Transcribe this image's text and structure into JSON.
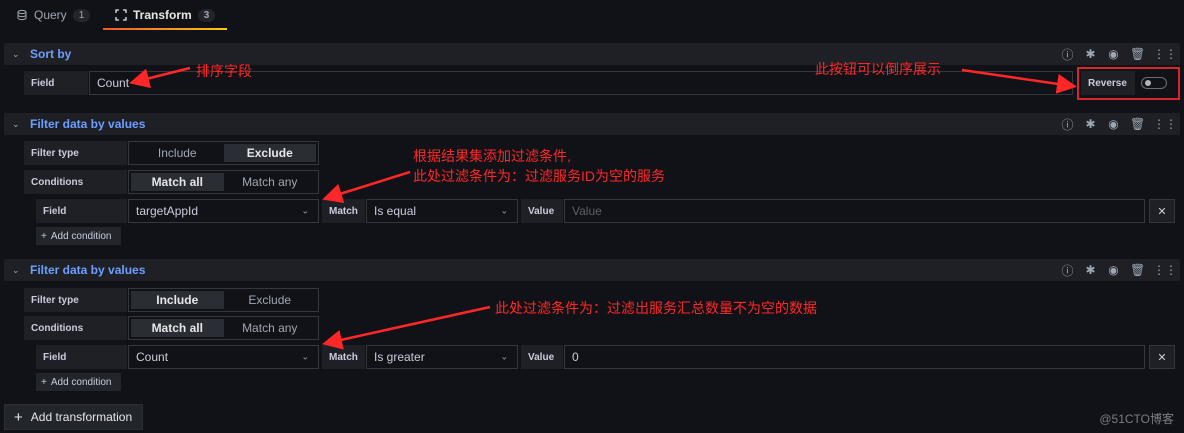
{
  "tabs": [
    {
      "label": "Query",
      "count": "1",
      "icon": "database-icon",
      "active": false
    },
    {
      "label": "Transform",
      "count": "3",
      "icon": "transform-icon",
      "active": true
    }
  ],
  "header_icons": [
    "info-icon",
    "debug-icon",
    "eye-icon",
    "trash-icon",
    "drag-handle-icon"
  ],
  "sort_by": {
    "title": "Sort by",
    "field_label": "Field",
    "field_value": "Count",
    "reverse_label": "Reverse",
    "reverse_enabled": false
  },
  "filters": [
    {
      "title": "Filter data by values",
      "filter_type_label": "Filter type",
      "filter_type_options": [
        "Include",
        "Exclude"
      ],
      "filter_type_selected": "Exclude",
      "conditions_label": "Conditions",
      "conditions_options": [
        "Match all",
        "Match any"
      ],
      "conditions_selected": "Match all",
      "field_label": "Field",
      "field_value": "targetAppId",
      "match_label": "Match",
      "match_value": "Is equal",
      "value_label": "Value",
      "value_value": "",
      "value_placeholder": "Value",
      "add_condition_label": "Add condition"
    },
    {
      "title": "Filter data by values",
      "filter_type_label": "Filter type",
      "filter_type_options": [
        "Include",
        "Exclude"
      ],
      "filter_type_selected": "Include",
      "conditions_label": "Conditions",
      "conditions_options": [
        "Match all",
        "Match any"
      ],
      "conditions_selected": "Match all",
      "field_label": "Field",
      "field_value": "Count",
      "match_label": "Match",
      "match_value": "Is greater",
      "value_label": "Value",
      "value_value": "0",
      "value_placeholder": "Value",
      "add_condition_label": "Add condition"
    }
  ],
  "annotations": {
    "sort_field": "排序字段",
    "reverse_note": "此按钮可以倒序展示",
    "filter1_line1": "根据结果集添加过滤条件,",
    "filter1_line2": "此处过滤条件为：过滤服务ID为空的服务",
    "filter2_line1": "此处过滤条件为：过滤出服务汇总数量不为空的数据"
  },
  "add_transformation_label": "Add transformation",
  "watermark": "@51CTO博客",
  "colors": {
    "accent_blue": "#6e9fff",
    "annotation_red": "#ff2727",
    "tab_underline": "#f05a28"
  }
}
